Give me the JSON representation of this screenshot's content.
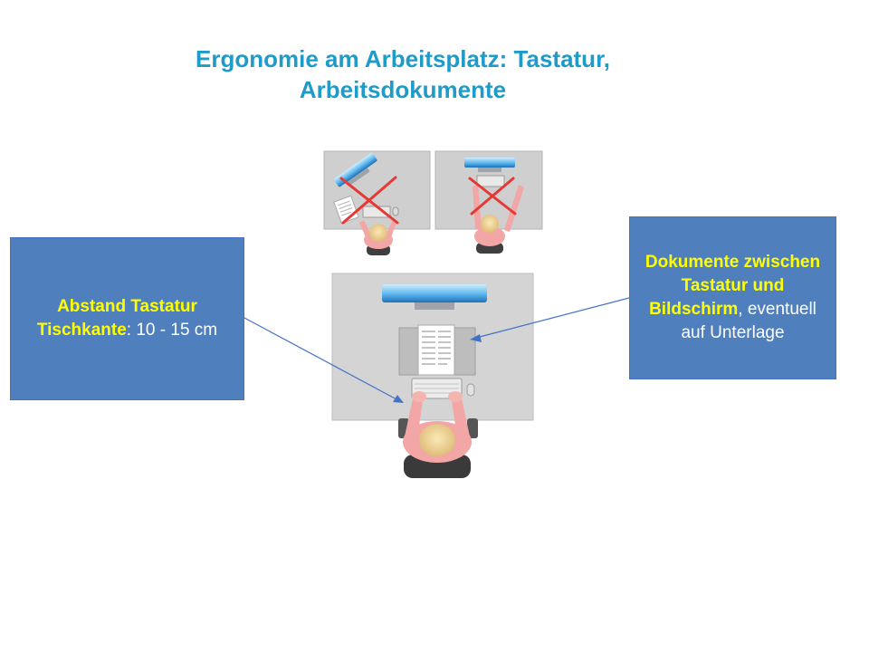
{
  "title": {
    "line1": "Ergonomie am Arbeitsplatz: Tastatur,",
    "line2": "Arbeitsdokumente"
  },
  "callout_left": {
    "highlight": "Abstand Tastatur Tischkante",
    "text": ": 10 - 15 cm"
  },
  "callout_right": {
    "highlight": "Dokumente zwischen Tastatur und Bildschirm",
    "text": ", eventuell auf Unterlage"
  },
  "colors": {
    "title": "#1f9bc9",
    "callout_bg": "#4f7fbd",
    "highlight": "#ffff00",
    "wrong_mark": "#e53935"
  },
  "illustrations": [
    {
      "name": "wrong-document-beside-monitor",
      "marked_wrong": true
    },
    {
      "name": "wrong-keyboard-too-far",
      "marked_wrong": true
    },
    {
      "name": "correct-workstation",
      "marked_wrong": false
    }
  ]
}
